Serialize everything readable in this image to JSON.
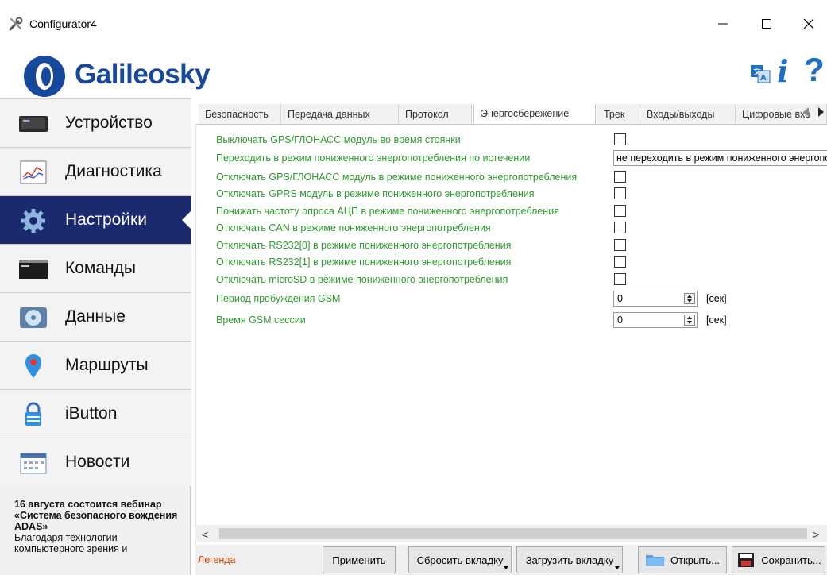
{
  "window": {
    "title": "Configurator4",
    "minimize_glyph": "—",
    "maximize_glyph": "☐",
    "close_glyph": "✕"
  },
  "header": {
    "logo_text": "Galileosky",
    "info_glyph": "i",
    "help_glyph": "?"
  },
  "sidebar": {
    "items": [
      {
        "label": "Устройство",
        "icon": "device-icon"
      },
      {
        "label": "Диагностика",
        "icon": "diagnostics-icon"
      },
      {
        "label": "Настройки",
        "icon": "settings-gear-icon",
        "active": true
      },
      {
        "label": "Команды",
        "icon": "commands-terminal-icon"
      },
      {
        "label": "Данные",
        "icon": "data-disk-icon"
      },
      {
        "label": "Маршруты",
        "icon": "map-pin-icon"
      },
      {
        "label": "iButton",
        "icon": "ibutton-lock-icon"
      },
      {
        "label": "Новости",
        "icon": "news-calendar-icon"
      }
    ],
    "news": {
      "title": "16 августа состоится вебинар «Система безопасного вождения ADAS»",
      "body": "Благодаря технологии компьютерного зрения и"
    },
    "accent_color": "#1b2a6e"
  },
  "tabs": [
    {
      "label": "Безопасность"
    },
    {
      "label": "Передача данных"
    },
    {
      "label": "Протокол"
    },
    {
      "label": "Энергосбережение",
      "active": true
    },
    {
      "label": "Трек"
    },
    {
      "label": "Входы/выходы"
    },
    {
      "label": "Цифровые вхо"
    }
  ],
  "settings": {
    "label_color": "#2f9b2f",
    "rows": [
      {
        "label": "Выключать GPS/ГЛОНАСС модуль во время стоянки",
        "control": "checkbox",
        "checked": false
      },
      {
        "label": "Переходить в режим пониженного энергопотребления по истечении",
        "control": "combo",
        "value": "не переходить в режим пониженного энергопотребления"
      },
      {
        "label": "Отключать GPS/ГЛОНАСС модуль в режиме пониженного энергопотребления",
        "control": "checkbox",
        "checked": false
      },
      {
        "label": "Отключать GPRS модуль в режиме пониженного энергопотребления",
        "control": "checkbox",
        "checked": false
      },
      {
        "label": "Понижать частоту опроса АЦП в режиме пониженного энергопотребления",
        "control": "checkbox",
        "checked": false
      },
      {
        "label": "Отключать CAN в режиме пониженного энергопотребления",
        "control": "checkbox",
        "checked": false
      },
      {
        "label": "Отключать RS232[0] в режиме пониженного энергопотребления",
        "control": "checkbox",
        "checked": false
      },
      {
        "label": "Отключать RS232[1] в режиме пониженного энергопотребления",
        "control": "checkbox",
        "checked": false
      },
      {
        "label": "Отключать microSD в режиме пониженного энергопотребления",
        "control": "checkbox",
        "checked": false
      },
      {
        "label": "Период пробуждения GSM",
        "control": "spin",
        "value": "0",
        "unit": "[сек]"
      },
      {
        "label": "Время GSM сессии",
        "control": "spin",
        "value": "0",
        "unit": "[сек]"
      }
    ]
  },
  "scrollbar": {
    "left_glyph": "<",
    "right_glyph": ">"
  },
  "bottom": {
    "legend": "Легенда",
    "apply": "Применить",
    "reset_tab": "Сбросить вкладку",
    "load_tab": "Загрузить вкладку",
    "open": "Открыть...",
    "save": "Сохранить..."
  }
}
